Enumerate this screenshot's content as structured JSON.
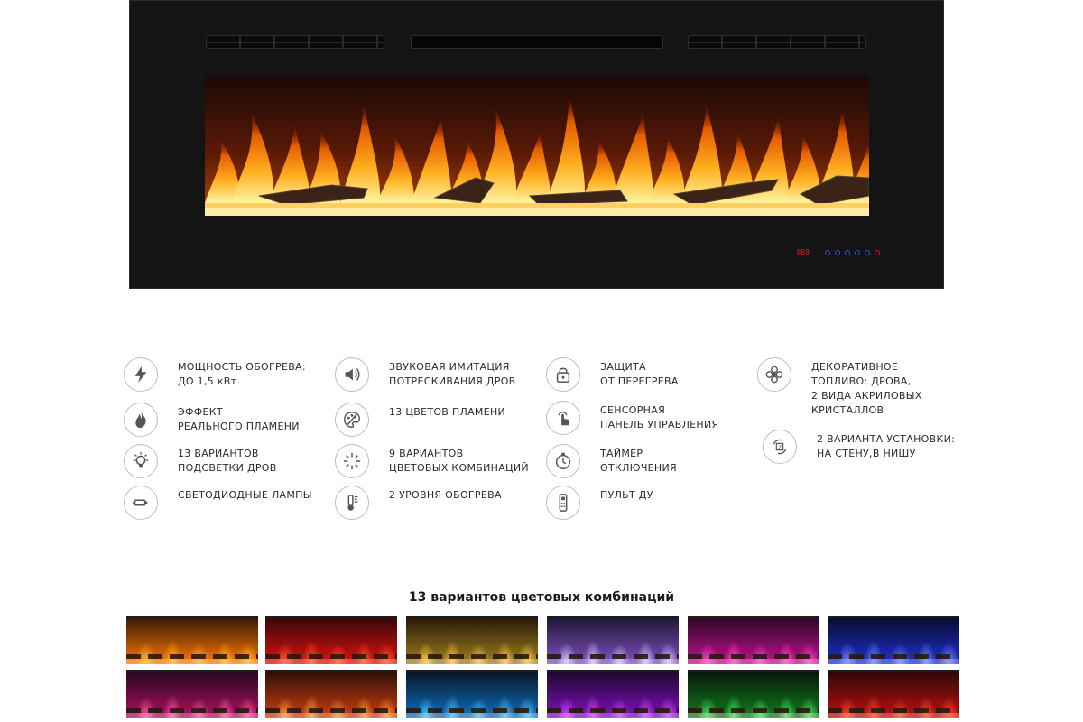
{
  "fireplace": {
    "display_digits": "888",
    "control_buttons": [
      {
        "icon": "power-icon",
        "color": "#3050d0"
      },
      {
        "icon": "timer-icon",
        "color": "#3050d0"
      },
      {
        "icon": "flame-color-icon",
        "color": "#3050d0"
      },
      {
        "icon": "heat-icon",
        "color": "#3050d0"
      },
      {
        "icon": "flame-icon",
        "color": "#3050d0"
      },
      {
        "icon": "heater-icon",
        "color": "#d02020"
      }
    ]
  },
  "features": [
    {
      "icon": "lightning-icon",
      "lines": [
        "МОЩНОСТЬ ОБОГРЕВА:",
        "ДО 1,5 кВт"
      ]
    },
    {
      "icon": "flame-icon",
      "lines": [
        "ЭФФЕКТ",
        "РЕАЛЬНОГО ПЛАМЕНИ"
      ]
    },
    {
      "icon": "bulb-icon",
      "lines": [
        "13 ВАРИАНТОВ",
        "ПОДСВЕТКИ ДРОВ"
      ]
    },
    {
      "icon": "led-lamp-icon",
      "lines": [
        "СВЕТОДИОДНЫЕ ЛАМПЫ"
      ]
    },
    {
      "icon": "speaker-icon",
      "lines": [
        "ЗВУКОВАЯ ИМИТАЦИЯ",
        "ПОТРЕСКИВАНИЯ ДРОВ"
      ]
    },
    {
      "icon": "palette-icon",
      "lines": [
        "13 ЦВЕТОВ ПЛАМЕНИ"
      ]
    },
    {
      "icon": "burst-icon",
      "lines": [
        "9 ВАРИАНТОВ",
        "ЦВЕТОВЫХ КОМБИНАЦИЙ"
      ]
    },
    {
      "icon": "thermometer-icon",
      "lines": [
        "2 УРОВНЯ ОБОГРЕВА"
      ]
    },
    {
      "icon": "lock-icon",
      "lines": [
        "ЗАЩИТА",
        "ОТ ПЕРЕГРЕВА"
      ]
    },
    {
      "icon": "touch-icon",
      "lines": [
        "СЕНСОРНАЯ",
        "ПАНЕЛЬ УПРАВЛЕНИЯ"
      ]
    },
    {
      "icon": "stopwatch-icon",
      "lines": [
        "ТАЙМЕР",
        "ОТКЛЮЧЕНИЯ"
      ]
    },
    {
      "icon": "remote-icon",
      "lines": [
        "ПУЛЬТ ДУ"
      ]
    },
    {
      "icon": "flower-icon",
      "lines": [
        "ДЕКОРАТИВНОЕ",
        "ТОПЛИВО: ДРОВА,",
        "2 ВИДА АКРИЛОВЫХ",
        "КРИСТАЛЛОВ"
      ]
    },
    {
      "icon": "two-options-icon",
      "lines": [
        "2 ВАРИАНТА УСТАНОВКИ:",
        "НА СТЕНУ,В НИШУ"
      ]
    }
  ],
  "variants": {
    "title": "13 вариантов цветовых комбинаций",
    "thumbnails": [
      {
        "top": "#3a1a08",
        "flame": "#ffb020",
        "glow": "#ff7a00"
      },
      {
        "top": "#3a0808",
        "flame": "#ff5020",
        "glow": "#e01010"
      },
      {
        "top": "#2a1a08",
        "flame": "#ffc040",
        "glow": "#a08020"
      },
      {
        "top": "#201838",
        "flame": "#d0c0ff",
        "glow": "#8050c0"
      },
      {
        "top": "#300828",
        "flame": "#ff40c0",
        "glow": "#c01090"
      },
      {
        "top": "#080c30",
        "flame": "#7080ff",
        "glow": "#2030d0"
      },
      {
        "top": "#280820",
        "flame": "#ff50a0",
        "glow": "#b01060"
      },
      {
        "top": "#301008",
        "flame": "#ff9030",
        "glow": "#d04010"
      },
      {
        "top": "#081828",
        "flame": "#40c0ff",
        "glow": "#1070c0"
      },
      {
        "top": "#200830",
        "flame": "#d040ff",
        "glow": "#8010c0"
      },
      {
        "top": "#081808",
        "flame": "#40e060",
        "glow": "#108020"
      },
      {
        "top": "#300808",
        "flame": "#ff4020",
        "glow": "#c01010"
      }
    ]
  }
}
